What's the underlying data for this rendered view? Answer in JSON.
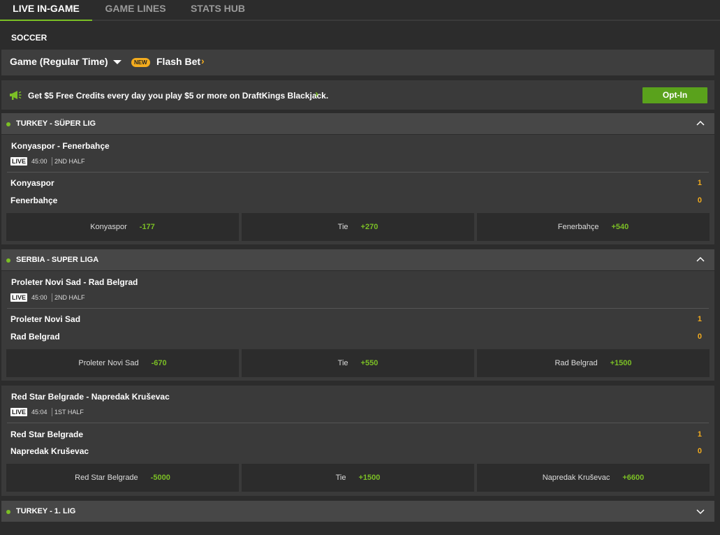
{
  "tabs": [
    "LIVE IN-GAME",
    "GAME LINES",
    "STATS HUB"
  ],
  "sport": "SOCCER",
  "filter": {
    "selected": "Game (Regular Time)",
    "new_badge": "NEW",
    "flash_bet": "Flash Bet"
  },
  "promo": {
    "text": "Get $5 Free Credits every day you play $5 or more on DraftKings Blackjack.",
    "button": "Opt-In"
  },
  "leagues": [
    {
      "name": "TURKEY - SÜPER LIG",
      "expanded": true,
      "events": [
        {
          "title": "Konyaspor - Fenerbahçe",
          "live": "LIVE",
          "clock": "45:00",
          "period": "2ND HALF",
          "teams": [
            {
              "name": "Konyaspor",
              "score": "1"
            },
            {
              "name": "Fenerbahçe",
              "score": "0"
            }
          ],
          "odds": [
            {
              "label": "Konyaspor",
              "price": "-177"
            },
            {
              "label": "Tie",
              "price": "+270"
            },
            {
              "label": "Fenerbahçe",
              "price": "+540"
            }
          ]
        }
      ]
    },
    {
      "name": "SERBIA - SUPER LIGA",
      "expanded": true,
      "events": [
        {
          "title": "Proleter Novi Sad - Rad Belgrad",
          "live": "LIVE",
          "clock": "45:00",
          "period": "2ND HALF",
          "teams": [
            {
              "name": "Proleter Novi Sad",
              "score": "1"
            },
            {
              "name": "Rad Belgrad",
              "score": "0"
            }
          ],
          "odds": [
            {
              "label": "Proleter Novi Sad",
              "price": "-670"
            },
            {
              "label": "Tie",
              "price": "+550"
            },
            {
              "label": "Rad Belgrad",
              "price": "+1500"
            }
          ]
        },
        {
          "title": "Red Star Belgrade - Napredak Kruševac",
          "live": "LIVE",
          "clock": "45:04",
          "period": "1ST HALF",
          "teams": [
            {
              "name": "Red Star Belgrade",
              "score": "1"
            },
            {
              "name": "Napredak Kruševac",
              "score": "0"
            }
          ],
          "odds": [
            {
              "label": "Red Star Belgrade",
              "price": "-5000"
            },
            {
              "label": "Tie",
              "price": "+1500"
            },
            {
              "label": "Napredak Kruševac",
              "price": "+6600"
            }
          ]
        }
      ]
    },
    {
      "name": "TURKEY - 1. LIG",
      "expanded": false,
      "events": []
    }
  ],
  "colors": {
    "accent_green": "#7bbf25",
    "score_orange": "#f3ac1e",
    "optin_green": "#5aa21c"
  }
}
